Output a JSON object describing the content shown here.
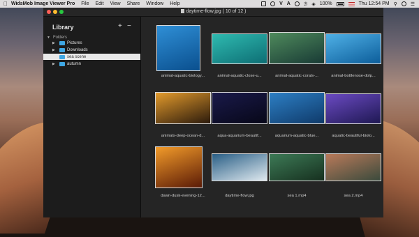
{
  "menubar": {
    "apple_icon": "apple-icon",
    "app_name": "WidsMob Image Viewer Pro",
    "menus": [
      "File",
      "Edit",
      "View",
      "Share",
      "Window",
      "Help"
    ],
    "battery": "100%",
    "clock": "Thu 12:54 PM"
  },
  "window": {
    "title": "daytime-flow.jpg ( 10 of 12 )"
  },
  "sidebar": {
    "title": "Library",
    "add_label": "+",
    "remove_label": "−",
    "section_label": "Folders",
    "folders": [
      {
        "label": "Pictures"
      },
      {
        "label": "Downloads"
      },
      {
        "label": "sea scene"
      },
      {
        "label": "autumn"
      }
    ]
  },
  "thumbnails": [
    {
      "caption": "animal-aquatic-biology...",
      "colors": [
        "#2f8fd6",
        "#0a4f8e"
      ]
    },
    {
      "caption": "animal-aquatic-close-u...",
      "colors": [
        "#2fbab0",
        "#0d6e74"
      ]
    },
    {
      "caption": "animal-aquatic-corals-...",
      "colors": [
        "#4f8a5c",
        "#183a35"
      ]
    },
    {
      "caption": "animal-bottlenose-dolp...",
      "colors": [
        "#4fb0e6",
        "#0c5d9a"
      ]
    },
    {
      "caption": "animals-deep-ocean-d...",
      "colors": [
        "#e29a2c",
        "#2b1a0c"
      ]
    },
    {
      "caption": "aqua-aquarium-beautif...",
      "colors": [
        "#1a1a4a",
        "#070718"
      ]
    },
    {
      "caption": "aquarium-aquatic-blue...",
      "colors": [
        "#2d7fc4",
        "#0f3a6a"
      ]
    },
    {
      "caption": "aquatic-beautiful-biolo...",
      "colors": [
        "#6b4ac2",
        "#1e1852"
      ]
    },
    {
      "caption": "dawn-dusk-evening-12...",
      "colors": [
        "#f29b2a",
        "#5a1a06"
      ]
    },
    {
      "caption": "daytime-flow.jpg",
      "colors": [
        "#2a5f86",
        "#dfe9ef"
      ]
    },
    {
      "caption": "sea 1.mp4",
      "colors": [
        "#3d7a56",
        "#16301f"
      ]
    },
    {
      "caption": "sea 2.mp4",
      "colors": [
        "#b97a5a",
        "#3a4a3c"
      ]
    }
  ]
}
